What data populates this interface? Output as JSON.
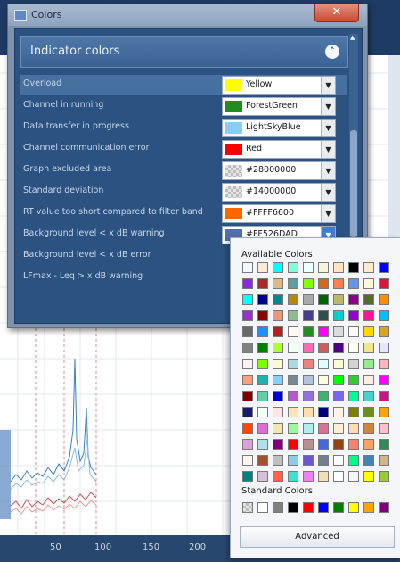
{
  "dialog": {
    "title": "Colors",
    "close_glyph": "✕",
    "section_title": "Indicator colors",
    "collapse_glyph": "˄"
  },
  "indicators": [
    {
      "label": "Overload",
      "value": "Yellow",
      "swatch": "#ffff00",
      "selected": true
    },
    {
      "label": "Channel in running",
      "value": "ForestGreen",
      "swatch": "#228b22"
    },
    {
      "label": "Data transfer in progress",
      "value": "LightSkyBlue",
      "swatch": "#87cefa"
    },
    {
      "label": "Channel communication error",
      "value": "Red",
      "swatch": "#ff0000"
    },
    {
      "label": "Graph excluded area",
      "value": "#28000000",
      "swatch": "checker"
    },
    {
      "label": "Standard deviation",
      "value": "#14000000",
      "swatch": "checker"
    },
    {
      "label": "RT value too short compared to filter band",
      "value": "#FFFF6600",
      "swatch": "#ff6600"
    },
    {
      "label": "Background level < x dB warning",
      "value": "#FF526DAD",
      "swatch": "#526dad",
      "open": true
    },
    {
      "label": "Background level < x dB error"
    },
    {
      "label": "LFmax - Leq > x dB warning"
    }
  ],
  "color_picker": {
    "available_label": "Available Colors",
    "standard_label": "Standard Colors",
    "advanced_label": "Advanced",
    "available_colors": [
      [
        "#f0f8ff",
        "#faebd7",
        "#00ffff",
        "#7fffd4",
        "#f0ffff",
        "#f5f5dc",
        "#ffe4c4",
        "#000000",
        "#ffebcd",
        "#0000ff"
      ],
      [
        "#8a2be2",
        "#a52a2a",
        "#deb887",
        "#5f9ea0",
        "#7fff00",
        "#d2691e",
        "#ff7f50",
        "#6495ed",
        "#fff8dc",
        "#dc143c"
      ],
      [
        "#00ffff",
        "#00008b",
        "#008b8b",
        "#b8860b",
        "#a9a9a9",
        "#006400",
        "#bdb76b",
        "#8b008b",
        "#556b2f",
        "#ff8c00"
      ],
      [
        "#9932cc",
        "#8b0000",
        "#e9967a",
        "#8fbc8f",
        "#483d8b",
        "#2f4f4f",
        "#00ced1",
        "#9400d3",
        "#ff1493",
        "#00bfff"
      ],
      [
        "#696969",
        "#1e90ff",
        "#b22222",
        "#fffaf0",
        "#228b22",
        "#ff00ff",
        "#dcdcdc",
        "#f8f8ff",
        "#ffd700",
        "#daa520"
      ],
      [
        "#808080",
        "#008000",
        "#adff2f",
        "#f0fff0",
        "#ff69b4",
        "#cd5c5c",
        "#4b0082",
        "#fffff0",
        "#f0e68c",
        "#e6e6fa"
      ],
      [
        "#fff0f5",
        "#7cfc00",
        "#fffacd",
        "#add8e6",
        "#f08080",
        "#e0ffff",
        "#fafad2",
        "#d3d3d3",
        "#90ee90",
        "#ffb6c1"
      ],
      [
        "#ffa07a",
        "#20b2aa",
        "#87cefa",
        "#778899",
        "#b0c4de",
        "#ffffe0",
        "#00ff00",
        "#32cd32",
        "#faf0e6",
        "#ff00ff"
      ],
      [
        "#800000",
        "#66cdaa",
        "#0000cd",
        "#ba55d3",
        "#9370db",
        "#3cb371",
        "#7b68ee",
        "#00fa9a",
        "#48d1cc",
        "#c71585"
      ],
      [
        "#191970",
        "#f5fffa",
        "#ffe4e1",
        "#ffe4b5",
        "#ffdead",
        "#000080",
        "#fdf5e6",
        "#808000",
        "#6b8e23",
        "#ffa500"
      ],
      [
        "#ff4500",
        "#da70d6",
        "#eee8aa",
        "#98fb98",
        "#afeeee",
        "#db7093",
        "#ffefd5",
        "#ffdab9",
        "#cd853f",
        "#ffc0cb"
      ],
      [
        "#dda0dd",
        "#b0e0e6",
        "#800080",
        "#ff0000",
        "#bc8f8f",
        "#4169e1",
        "#8b4513",
        "#fa8072",
        "#f4a460",
        "#2e8b57"
      ],
      [
        "#fff5ee",
        "#a0522d",
        "#c0c0c0",
        "#87ceeb",
        "#6a5acd",
        "#708090",
        "#fffafa",
        "#00ff7f",
        "#4682b4",
        "#d2b48c"
      ],
      [
        "#008080",
        "#d8bfd8",
        "#ff6347",
        "#40e0d0",
        "#ee82ee",
        "#f5deb3",
        "#ffffff",
        "#f5f5f5",
        "#ffff00",
        "#9acd32"
      ]
    ],
    "standard_colors": [
      "checker",
      "#ffffff",
      "#808080",
      "#000000",
      "#ff0000",
      "#0000ff",
      "#008000",
      "#ffff00",
      "#ffa500",
      "#800080"
    ]
  },
  "graph": {
    "x_ticks": [
      "50",
      "100",
      "150",
      "200"
    ]
  }
}
